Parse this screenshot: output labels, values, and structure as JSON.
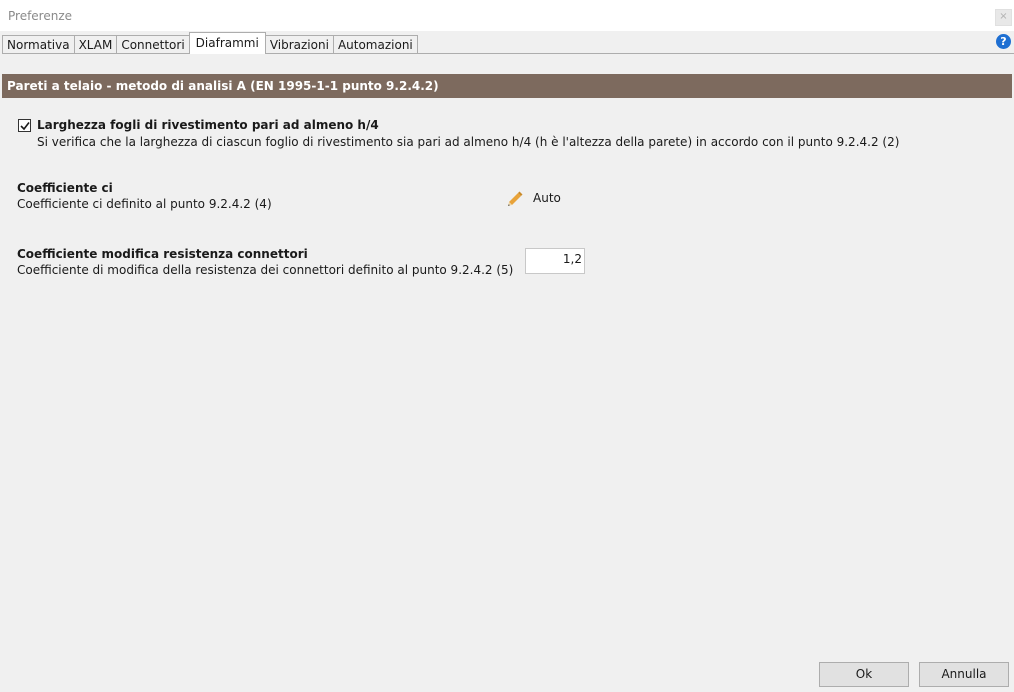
{
  "window": {
    "title": "Preferenze",
    "close_glyph": "×"
  },
  "tabs": [
    {
      "label": "Normativa",
      "active": false
    },
    {
      "label": "XLAM",
      "active": false
    },
    {
      "label": "Connettori",
      "active": false
    },
    {
      "label": "Diaframmi",
      "active": true
    },
    {
      "label": "Vibrazioni",
      "active": false
    },
    {
      "label": "Automazioni",
      "active": false
    }
  ],
  "help_glyph": "?",
  "section": {
    "title": "Pareti a telaio - metodo di analisi A (EN 1995-1-1 punto 9.2.4.2)",
    "color": "#7d6a5e"
  },
  "options": {
    "sheet_width": {
      "checked": true,
      "title": "Larghezza fogli di rivestimento pari ad almeno h/4",
      "description": "Si verifica che la larghezza di ciascun foglio di rivestimento sia pari ad almeno h/4 (h è l'altezza della parete) in accordo con il punto 9.2.4.2 (2)"
    },
    "coefficient_ci": {
      "title": "Coefficiente ci",
      "description": "Coefficiente ci definito al punto 9.2.4.2 (4)",
      "value": "Auto",
      "icon": "pencil-icon"
    },
    "connector_modifier": {
      "title": "Coefficiente modifica resistenza connettori",
      "description": "Coefficiente di modifica della resistenza dei connettori definito al punto 9.2.4.2 (5)",
      "value": "1,2"
    }
  },
  "buttons": {
    "ok": "Ok",
    "cancel": "Annulla"
  }
}
